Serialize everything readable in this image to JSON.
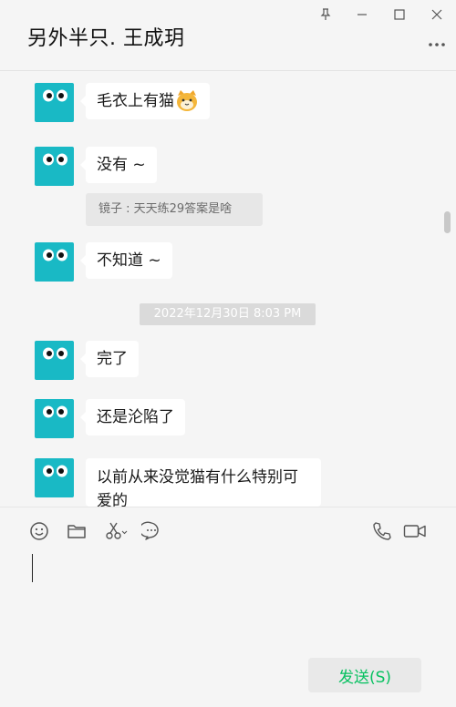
{
  "header": {
    "title": "另外半只. 王成玥"
  },
  "messages": [
    {
      "text": "毛衣上有猫",
      "emoji": "cat-face-emoji"
    },
    {
      "text": "没有 ~"
    },
    {
      "quote": "镜子 : 天天练29答案是啥"
    },
    {
      "text": "不知道 ~"
    },
    {
      "timestamp": "2022年12月30日 8:03 PM"
    },
    {
      "text": "完了"
    },
    {
      "text": "还是沦陷了"
    },
    {
      "text": "以前从来没觉猫有什么特别可爱的"
    }
  ],
  "toolbar": {
    "icons": [
      "emoji-icon",
      "folder-icon",
      "scissors-icon",
      "chat-bubble-icon",
      "phone-icon",
      "video-icon"
    ]
  },
  "input": {
    "value": ""
  },
  "send_button": {
    "label": "发送(S)"
  },
  "colors": {
    "avatar": "#19b9c5",
    "send_text": "#07c160",
    "background": "#f5f5f5"
  }
}
